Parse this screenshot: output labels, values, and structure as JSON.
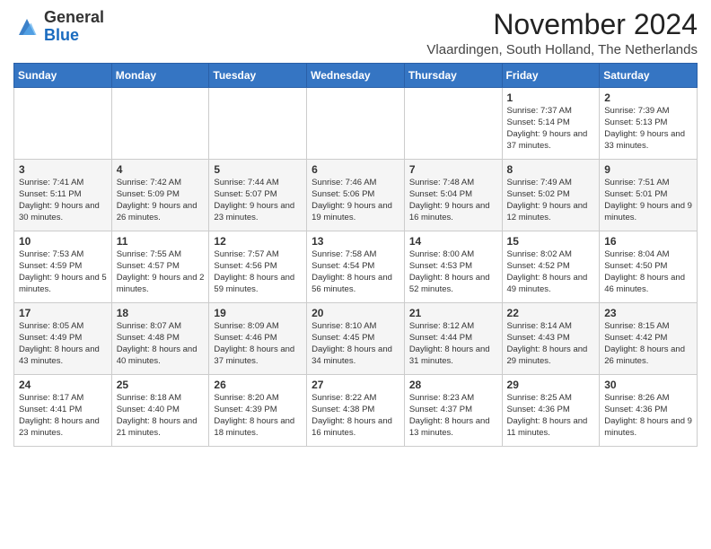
{
  "header": {
    "logo_general": "General",
    "logo_blue": "Blue",
    "month_title": "November 2024",
    "location": "Vlaardingen, South Holland, The Netherlands"
  },
  "weekdays": [
    "Sunday",
    "Monday",
    "Tuesday",
    "Wednesday",
    "Thursday",
    "Friday",
    "Saturday"
  ],
  "weeks": [
    [
      {
        "day": "",
        "info": ""
      },
      {
        "day": "",
        "info": ""
      },
      {
        "day": "",
        "info": ""
      },
      {
        "day": "",
        "info": ""
      },
      {
        "day": "",
        "info": ""
      },
      {
        "day": "1",
        "info": "Sunrise: 7:37 AM\nSunset: 5:14 PM\nDaylight: 9 hours and 37 minutes."
      },
      {
        "day": "2",
        "info": "Sunrise: 7:39 AM\nSunset: 5:13 PM\nDaylight: 9 hours and 33 minutes."
      }
    ],
    [
      {
        "day": "3",
        "info": "Sunrise: 7:41 AM\nSunset: 5:11 PM\nDaylight: 9 hours and 30 minutes."
      },
      {
        "day": "4",
        "info": "Sunrise: 7:42 AM\nSunset: 5:09 PM\nDaylight: 9 hours and 26 minutes."
      },
      {
        "day": "5",
        "info": "Sunrise: 7:44 AM\nSunset: 5:07 PM\nDaylight: 9 hours and 23 minutes."
      },
      {
        "day": "6",
        "info": "Sunrise: 7:46 AM\nSunset: 5:06 PM\nDaylight: 9 hours and 19 minutes."
      },
      {
        "day": "7",
        "info": "Sunrise: 7:48 AM\nSunset: 5:04 PM\nDaylight: 9 hours and 16 minutes."
      },
      {
        "day": "8",
        "info": "Sunrise: 7:49 AM\nSunset: 5:02 PM\nDaylight: 9 hours and 12 minutes."
      },
      {
        "day": "9",
        "info": "Sunrise: 7:51 AM\nSunset: 5:01 PM\nDaylight: 9 hours and 9 minutes."
      }
    ],
    [
      {
        "day": "10",
        "info": "Sunrise: 7:53 AM\nSunset: 4:59 PM\nDaylight: 9 hours and 5 minutes."
      },
      {
        "day": "11",
        "info": "Sunrise: 7:55 AM\nSunset: 4:57 PM\nDaylight: 9 hours and 2 minutes."
      },
      {
        "day": "12",
        "info": "Sunrise: 7:57 AM\nSunset: 4:56 PM\nDaylight: 8 hours and 59 minutes."
      },
      {
        "day": "13",
        "info": "Sunrise: 7:58 AM\nSunset: 4:54 PM\nDaylight: 8 hours and 56 minutes."
      },
      {
        "day": "14",
        "info": "Sunrise: 8:00 AM\nSunset: 4:53 PM\nDaylight: 8 hours and 52 minutes."
      },
      {
        "day": "15",
        "info": "Sunrise: 8:02 AM\nSunset: 4:52 PM\nDaylight: 8 hours and 49 minutes."
      },
      {
        "day": "16",
        "info": "Sunrise: 8:04 AM\nSunset: 4:50 PM\nDaylight: 8 hours and 46 minutes."
      }
    ],
    [
      {
        "day": "17",
        "info": "Sunrise: 8:05 AM\nSunset: 4:49 PM\nDaylight: 8 hours and 43 minutes."
      },
      {
        "day": "18",
        "info": "Sunrise: 8:07 AM\nSunset: 4:48 PM\nDaylight: 8 hours and 40 minutes."
      },
      {
        "day": "19",
        "info": "Sunrise: 8:09 AM\nSunset: 4:46 PM\nDaylight: 8 hours and 37 minutes."
      },
      {
        "day": "20",
        "info": "Sunrise: 8:10 AM\nSunset: 4:45 PM\nDaylight: 8 hours and 34 minutes."
      },
      {
        "day": "21",
        "info": "Sunrise: 8:12 AM\nSunset: 4:44 PM\nDaylight: 8 hours and 31 minutes."
      },
      {
        "day": "22",
        "info": "Sunrise: 8:14 AM\nSunset: 4:43 PM\nDaylight: 8 hours and 29 minutes."
      },
      {
        "day": "23",
        "info": "Sunrise: 8:15 AM\nSunset: 4:42 PM\nDaylight: 8 hours and 26 minutes."
      }
    ],
    [
      {
        "day": "24",
        "info": "Sunrise: 8:17 AM\nSunset: 4:41 PM\nDaylight: 8 hours and 23 minutes."
      },
      {
        "day": "25",
        "info": "Sunrise: 8:18 AM\nSunset: 4:40 PM\nDaylight: 8 hours and 21 minutes."
      },
      {
        "day": "26",
        "info": "Sunrise: 8:20 AM\nSunset: 4:39 PM\nDaylight: 8 hours and 18 minutes."
      },
      {
        "day": "27",
        "info": "Sunrise: 8:22 AM\nSunset: 4:38 PM\nDaylight: 8 hours and 16 minutes."
      },
      {
        "day": "28",
        "info": "Sunrise: 8:23 AM\nSunset: 4:37 PM\nDaylight: 8 hours and 13 minutes."
      },
      {
        "day": "29",
        "info": "Sunrise: 8:25 AM\nSunset: 4:36 PM\nDaylight: 8 hours and 11 minutes."
      },
      {
        "day": "30",
        "info": "Sunrise: 8:26 AM\nSunset: 4:36 PM\nDaylight: 8 hours and 9 minutes."
      }
    ]
  ]
}
